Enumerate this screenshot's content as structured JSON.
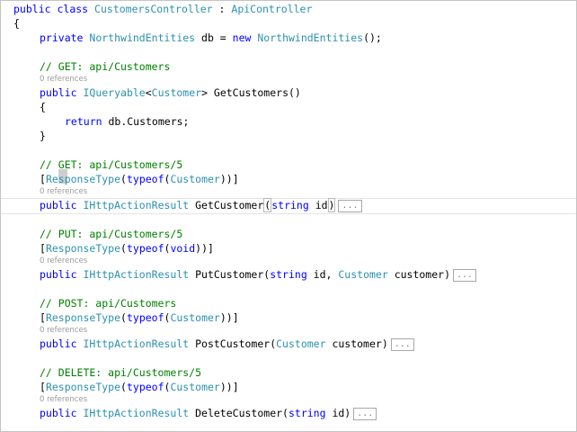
{
  "code": {
    "class_decl": {
      "kw1": "public",
      "kw2": "class",
      "class_name": "CustomersController",
      "colon": " : ",
      "base": "ApiController"
    },
    "open_brace": "{",
    "field": {
      "kw1": "private",
      "type": "NorthwindEntities",
      "mid": " db = ",
      "kw2": "new",
      "ctor": "NorthwindEntities",
      "tail": "();"
    },
    "get_all": {
      "comment": "// GET: api/Customers",
      "refs": "0 references",
      "kw": "public",
      "ret": "IQueryable",
      "lt": "<",
      "generic": "Customer",
      "sig": "> GetCustomers()",
      "open": "{",
      "return_kw": "return",
      "return_body": " db.Customers;",
      "close": "}"
    },
    "get_one": {
      "comment": "// GET: api/Customers/5",
      "attr_open": "[",
      "attr_name": "ResponseType",
      "attr_mid": "(",
      "typeof": "typeof",
      "arg_open": "(",
      "arg": "Customer",
      "attr_close": "))]",
      "refs": "0 references",
      "kw": "public",
      "ret": "IHttpActionResult",
      "name": " GetCustomer",
      "paren_open": "(",
      "ptype": "string",
      "pname": " id",
      "paren_close": ")",
      "fold": "..."
    },
    "put": {
      "comment": "// PUT: api/Customers/5",
      "attr_open": "[",
      "attr_name": "ResponseType",
      "attr_mid": "(",
      "typeof": "typeof",
      "arg_open": "(",
      "arg": "void",
      "attr_close": "))]",
      "refs": "0 references",
      "kw": "public",
      "ret": "IHttpActionResult",
      "name": " PutCustomer(",
      "ptype1": "string",
      "pname1": " id, ",
      "ptype2": "Customer",
      "pname2": " customer)",
      "fold": "..."
    },
    "post": {
      "comment": "// POST: api/Customers",
      "attr_open": "[",
      "attr_name": "ResponseType",
      "attr_mid": "(",
      "typeof": "typeof",
      "arg_open": "(",
      "arg": "Customer",
      "attr_close": "))]",
      "refs": "0 references",
      "kw": "public",
      "ret": "IHttpActionResult",
      "name": " PostCustomer(",
      "ptype": "Customer",
      "pname": " customer)",
      "fold": "..."
    },
    "delete": {
      "comment": "// DELETE: api/Customers/5",
      "attr_open": "[",
      "attr_name": "ResponseType",
      "attr_mid": "(",
      "typeof": "typeof",
      "arg_open": "(",
      "arg": "Customer",
      "attr_close": "))]",
      "refs": "0 references",
      "kw": "public",
      "ret": "IHttpActionResult",
      "name": " DeleteCustomer(",
      "ptype": "string",
      "pname": " id)",
      "fold": "..."
    }
  },
  "colors": {
    "keyword": "#0000ff",
    "type": "#2b91af",
    "comment": "#008000",
    "codelens": "#9a9a9a"
  }
}
